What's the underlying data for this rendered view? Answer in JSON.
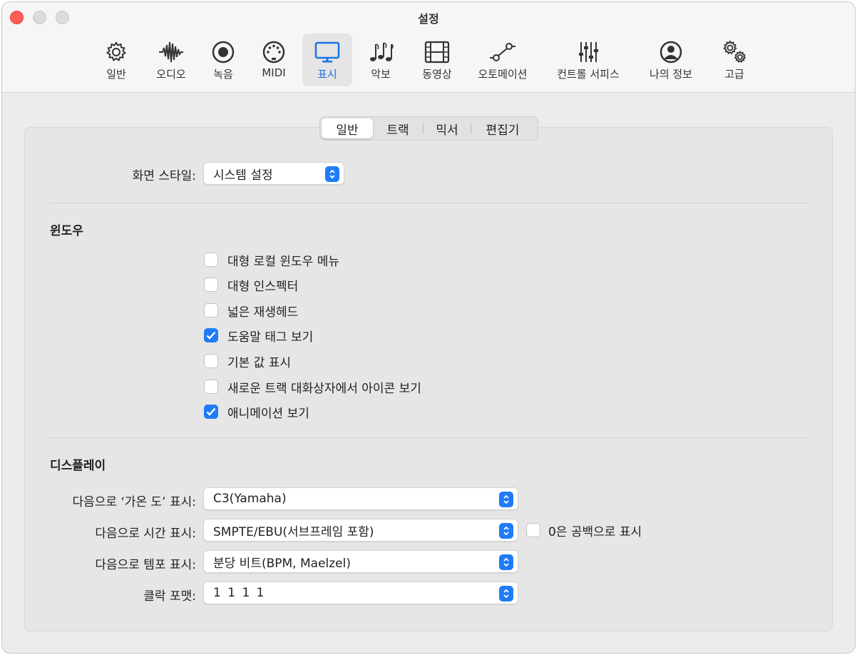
{
  "window": {
    "title": "설정"
  },
  "toolbar": [
    {
      "label": "일반",
      "icon": "gear-icon"
    },
    {
      "label": "오디오",
      "icon": "waveform-icon"
    },
    {
      "label": "녹음",
      "icon": "record-icon"
    },
    {
      "label": "MIDI",
      "icon": "midi-port-icon"
    },
    {
      "label": "표시",
      "icon": "display-icon",
      "active": true
    },
    {
      "label": "악보",
      "icon": "music-notes-icon"
    },
    {
      "label": "동영상",
      "icon": "film-icon"
    },
    {
      "label": "오토메이션",
      "icon": "automation-icon"
    },
    {
      "label": "컨트롤 서피스",
      "icon": "sliders-icon"
    },
    {
      "label": "나의 정보",
      "icon": "person-icon"
    },
    {
      "label": "고급",
      "icon": "gears-icon"
    }
  ],
  "tabs": [
    {
      "label": "일반",
      "active": true
    },
    {
      "label": "트랙"
    },
    {
      "label": "믹서"
    },
    {
      "label": "편집기"
    }
  ],
  "screen_style": {
    "label": "화면 스타일:",
    "value": "시스템 설정"
  },
  "windows_section": {
    "title": "윈도우",
    "options": [
      {
        "label": "대형 로컬 윈도우 메뉴",
        "checked": false
      },
      {
        "label": "대형 인스펙터",
        "checked": false
      },
      {
        "label": "넓은 재생헤드",
        "checked": false
      },
      {
        "label": "도움말 태그 보기",
        "checked": true
      },
      {
        "label": "기본 값 표시",
        "checked": false
      },
      {
        "label": "새로운 트랙 대화상자에서 아이콘 보기",
        "checked": false
      },
      {
        "label": "애니메이션 보기",
        "checked": true
      }
    ]
  },
  "display_section": {
    "title": "디스플레이",
    "middle_c": {
      "label": "다음으로 ‘가온 도’ 표시:",
      "value": "C3(Yamaha)"
    },
    "time": {
      "label": "다음으로 시간 표시:",
      "value": "SMPTE/EBU(서브프레임 포함)"
    },
    "zero_as_space": {
      "label": "0은 공백으로 표시",
      "checked": false
    },
    "tempo": {
      "label": "다음으로 템포 표시:",
      "value": "분당 비트(BPM, Maelzel)"
    },
    "clock_format": {
      "label": "클락 포맷:",
      "value": "1 1 1 1"
    }
  },
  "colors": {
    "accent": "#1f7cf6",
    "close": "#ff5f57"
  }
}
